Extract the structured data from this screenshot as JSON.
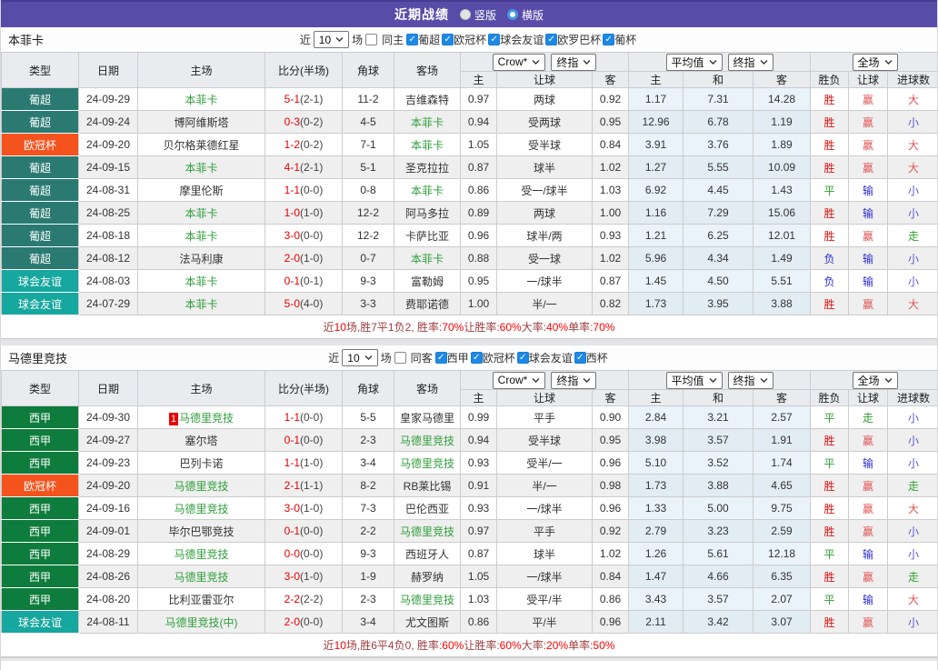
{
  "title_bar": {
    "title": "近期战绩",
    "radios": [
      {
        "label": "竖版",
        "selected": false
      },
      {
        "label": "横版",
        "selected": true
      }
    ]
  },
  "filter_words": {
    "near": "近",
    "count": "10",
    "games": "场"
  },
  "columns": {
    "type": "类型",
    "date": "日期",
    "home": "主场",
    "score": "比分(半场)",
    "corner": "角球",
    "away": "客场",
    "odds_home": "主",
    "odds_handicap": "让球",
    "odds_away": "客",
    "avg_home": "主",
    "avg_draw": "和",
    "avg_away": "客",
    "result_wdl": "胜负",
    "result_handicap": "让球",
    "result_goals": "进球数"
  },
  "dropdowns": {
    "company": "Crow*",
    "final1": "终指",
    "average": "平均值",
    "final2": "终指",
    "fulltime": "全场"
  },
  "colors": {
    "title_bar_bg": "#584ca8",
    "focal_team": "#2e9e3a",
    "score_red": "#e60000",
    "league_badge": {
      "葡超": "#2a7a72",
      "欧冠杯": "#f5531e",
      "球会友谊": "#16a79e",
      "西甲": "#0e7c3c"
    },
    "result": {
      "胜": "#e01010",
      "平": "#2f9e2f",
      "负": "#2b2bd5",
      "赢": "#e05555",
      "输": "#2b2bd5",
      "走": "#2f9e2f",
      "大": "#e05555",
      "小": "#5a55d2"
    }
  },
  "sections": [
    {
      "team": "本菲卡",
      "same_label": "同主",
      "same_checked": false,
      "leagues": [
        {
          "label": "葡超",
          "checked": true
        },
        {
          "label": "欧冠杯",
          "checked": true
        },
        {
          "label": "球会友谊",
          "checked": true
        },
        {
          "label": "欧罗巴杯",
          "checked": true
        },
        {
          "label": "葡杯",
          "checked": true
        }
      ],
      "rows": [
        {
          "type": "葡超",
          "date": "24-09-29",
          "home": "本菲卡",
          "home_focal": true,
          "home_badge": "",
          "score": "5-1",
          "half": "(2-1)",
          "corner": "11-2",
          "away": "吉维森特",
          "away_focal": false,
          "odds": [
            "0.97",
            "两球",
            "0.92"
          ],
          "avg": [
            "1.17",
            "7.31",
            "14.28"
          ],
          "results": [
            "胜",
            "赢",
            "大"
          ]
        },
        {
          "type": "葡超",
          "date": "24-09-24",
          "home": "博阿维斯塔",
          "home_focal": false,
          "home_badge": "",
          "score": "0-3",
          "half": "(0-2)",
          "corner": "4-5",
          "away": "本菲卡",
          "away_focal": true,
          "odds": [
            "0.94",
            "受两球",
            "0.95"
          ],
          "avg": [
            "12.96",
            "6.78",
            "1.19"
          ],
          "results": [
            "胜",
            "赢",
            "小"
          ]
        },
        {
          "type": "欧冠杯",
          "date": "24-09-20",
          "home": "贝尔格莱德红星",
          "home_focal": false,
          "home_badge": "",
          "score": "1-2",
          "half": "(0-2)",
          "corner": "7-1",
          "away": "本菲卡",
          "away_focal": true,
          "odds": [
            "1.05",
            "受半球",
            "0.84"
          ],
          "avg": [
            "3.91",
            "3.76",
            "1.89"
          ],
          "results": [
            "胜",
            "赢",
            "大"
          ]
        },
        {
          "type": "葡超",
          "date": "24-09-15",
          "home": "本菲卡",
          "home_focal": true,
          "home_badge": "",
          "score": "4-1",
          "half": "(2-1)",
          "corner": "5-1",
          "away": "圣克拉拉",
          "away_focal": false,
          "odds": [
            "0.87",
            "球半",
            "1.02"
          ],
          "avg": [
            "1.27",
            "5.55",
            "10.09"
          ],
          "results": [
            "胜",
            "赢",
            "大"
          ]
        },
        {
          "type": "葡超",
          "date": "24-08-31",
          "home": "摩里伦斯",
          "home_focal": false,
          "home_badge": "",
          "score": "1-1",
          "half": "(0-0)",
          "corner": "0-8",
          "away": "本菲卡",
          "away_focal": true,
          "odds": [
            "0.86",
            "受一/球半",
            "1.03"
          ],
          "avg": [
            "6.92",
            "4.45",
            "1.43"
          ],
          "results": [
            "平",
            "输",
            "小"
          ]
        },
        {
          "type": "葡超",
          "date": "24-08-25",
          "home": "本菲卡",
          "home_focal": true,
          "home_badge": "",
          "score": "1-0",
          "half": "(1-0)",
          "corner": "12-2",
          "away": "阿马多拉",
          "away_focal": false,
          "odds": [
            "0.89",
            "两球",
            "1.00"
          ],
          "avg": [
            "1.16",
            "7.29",
            "15.06"
          ],
          "results": [
            "胜",
            "输",
            "小"
          ]
        },
        {
          "type": "葡超",
          "date": "24-08-18",
          "home": "本菲卡",
          "home_focal": true,
          "home_badge": "",
          "score": "3-0",
          "half": "(0-0)",
          "corner": "12-2",
          "away": "卡萨比亚",
          "away_focal": false,
          "odds": [
            "0.96",
            "球半/两",
            "0.93"
          ],
          "avg": [
            "1.21",
            "6.25",
            "12.01"
          ],
          "results": [
            "胜",
            "赢",
            "走"
          ]
        },
        {
          "type": "葡超",
          "date": "24-08-12",
          "home": "法马利康",
          "home_focal": false,
          "home_badge": "",
          "score": "2-0",
          "half": "(1-0)",
          "corner": "0-7",
          "away": "本菲卡",
          "away_focal": true,
          "odds": [
            "0.88",
            "受一球",
            "1.02"
          ],
          "avg": [
            "5.96",
            "4.34",
            "1.49"
          ],
          "results": [
            "负",
            "输",
            "小"
          ]
        },
        {
          "type": "球会友谊",
          "date": "24-08-03",
          "home": "本菲卡",
          "home_focal": true,
          "home_badge": "",
          "score": "0-1",
          "half": "(0-1)",
          "corner": "9-3",
          "away": "富勒姆",
          "away_focal": false,
          "odds": [
            "0.95",
            "一/球半",
            "0.87"
          ],
          "avg": [
            "1.45",
            "4.50",
            "5.51"
          ],
          "results": [
            "负",
            "输",
            "小"
          ]
        },
        {
          "type": "球会友谊",
          "date": "24-07-29",
          "home": "本菲卡",
          "home_focal": true,
          "home_badge": "",
          "score": "5-0",
          "half": "(4-0)",
          "corner": "3-3",
          "away": "费耶诺德",
          "away_focal": false,
          "odds": [
            "1.00",
            "半/一",
            "0.82"
          ],
          "avg": [
            "1.73",
            "3.95",
            "3.88"
          ],
          "results": [
            "胜",
            "赢",
            "大"
          ]
        }
      ],
      "summary": [
        {
          "text": "近",
          "red": false
        },
        {
          "text": "10",
          "red": true
        },
        {
          "text": "场,胜7平1负2, 胜率:",
          "red": false
        },
        {
          "text": "70%",
          "red": true
        },
        {
          "text": " 让胜率:",
          "red": false
        },
        {
          "text": "60%",
          "red": true
        },
        {
          "text": " 大率:",
          "red": false
        },
        {
          "text": "40%",
          "red": true
        },
        {
          "text": " 单率:",
          "red": false
        },
        {
          "text": "70%",
          "red": true
        }
      ]
    },
    {
      "team": "马德里竞技",
      "same_label": "同客",
      "same_checked": false,
      "leagues": [
        {
          "label": "西甲",
          "checked": true
        },
        {
          "label": "欧冠杯",
          "checked": true
        },
        {
          "label": "球会友谊",
          "checked": true
        },
        {
          "label": "西杯",
          "checked": true
        }
      ],
      "rows": [
        {
          "type": "西甲",
          "date": "24-09-30",
          "home": "马德里竞技",
          "home_focal": true,
          "home_badge": "1",
          "score": "1-1",
          "half": "(0-0)",
          "corner": "5-5",
          "away": "皇家马德里",
          "away_focal": false,
          "odds": [
            "0.99",
            "平手",
            "0.90"
          ],
          "avg": [
            "2.84",
            "3.21",
            "2.57"
          ],
          "results": [
            "平",
            "走",
            "小"
          ]
        },
        {
          "type": "西甲",
          "date": "24-09-27",
          "home": "塞尔塔",
          "home_focal": false,
          "home_badge": "",
          "score": "0-1",
          "half": "(0-0)",
          "corner": "2-3",
          "away": "马德里竞技",
          "away_focal": true,
          "odds": [
            "0.94",
            "受半球",
            "0.95"
          ],
          "avg": [
            "3.98",
            "3.57",
            "1.91"
          ],
          "results": [
            "胜",
            "赢",
            "小"
          ]
        },
        {
          "type": "西甲",
          "date": "24-09-23",
          "home": "巴列卡诺",
          "home_focal": false,
          "home_badge": "",
          "score": "1-1",
          "half": "(1-0)",
          "corner": "3-4",
          "away": "马德里竞技",
          "away_focal": true,
          "odds": [
            "0.93",
            "受半/一",
            "0.96"
          ],
          "avg": [
            "5.10",
            "3.52",
            "1.74"
          ],
          "results": [
            "平",
            "输",
            "小"
          ]
        },
        {
          "type": "欧冠杯",
          "date": "24-09-20",
          "home": "马德里竞技",
          "home_focal": true,
          "home_badge": "",
          "score": "2-1",
          "half": "(1-1)",
          "corner": "8-2",
          "away": "RB莱比锡",
          "away_focal": false,
          "odds": [
            "0.91",
            "半/一",
            "0.98"
          ],
          "avg": [
            "1.73",
            "3.88",
            "4.65"
          ],
          "results": [
            "胜",
            "赢",
            "走"
          ]
        },
        {
          "type": "西甲",
          "date": "24-09-16",
          "home": "马德里竞技",
          "home_focal": true,
          "home_badge": "",
          "score": "3-0",
          "half": "(1-0)",
          "corner": "7-3",
          "away": "巴伦西亚",
          "away_focal": false,
          "odds": [
            "0.93",
            "一/球半",
            "0.96"
          ],
          "avg": [
            "1.33",
            "5.00",
            "9.75"
          ],
          "results": [
            "胜",
            "赢",
            "大"
          ]
        },
        {
          "type": "西甲",
          "date": "24-09-01",
          "home": "毕尔巴鄂竞技",
          "home_focal": false,
          "home_badge": "",
          "score": "0-1",
          "half": "(0-0)",
          "corner": "2-2",
          "away": "马德里竞技",
          "away_focal": true,
          "odds": [
            "0.97",
            "平手",
            "0.92"
          ],
          "avg": [
            "2.79",
            "3.23",
            "2.59"
          ],
          "results": [
            "胜",
            "赢",
            "小"
          ]
        },
        {
          "type": "西甲",
          "date": "24-08-29",
          "home": "马德里竞技",
          "home_focal": true,
          "home_badge": "",
          "score": "0-0",
          "half": "(0-0)",
          "corner": "9-3",
          "away": "西班牙人",
          "away_focal": false,
          "odds": [
            "0.87",
            "球半",
            "1.02"
          ],
          "avg": [
            "1.26",
            "5.61",
            "12.18"
          ],
          "results": [
            "平",
            "输",
            "小"
          ]
        },
        {
          "type": "西甲",
          "date": "24-08-26",
          "home": "马德里竞技",
          "home_focal": true,
          "home_badge": "",
          "score": "3-0",
          "half": "(1-0)",
          "corner": "1-9",
          "away": "赫罗纳",
          "away_focal": false,
          "odds": [
            "1.05",
            "一/球半",
            "0.84"
          ],
          "avg": [
            "1.47",
            "4.66",
            "6.35"
          ],
          "results": [
            "胜",
            "赢",
            "走"
          ]
        },
        {
          "type": "西甲",
          "date": "24-08-20",
          "home": "比利亚雷亚尔",
          "home_focal": false,
          "home_badge": "",
          "score": "2-2",
          "half": "(2-2)",
          "corner": "2-3",
          "away": "马德里竞技",
          "away_focal": true,
          "odds": [
            "1.03",
            "受平/半",
            "0.86"
          ],
          "avg": [
            "3.43",
            "3.57",
            "2.07"
          ],
          "results": [
            "平",
            "输",
            "大"
          ]
        },
        {
          "type": "球会友谊",
          "date": "24-08-11",
          "home": "马德里竞技(中)",
          "home_focal": true,
          "home_badge": "",
          "score": "2-0",
          "half": "(0-0)",
          "corner": "3-4",
          "away": "尤文图斯",
          "away_focal": false,
          "odds": [
            "0.86",
            "平/半",
            "0.96"
          ],
          "avg": [
            "2.11",
            "3.42",
            "3.07"
          ],
          "results": [
            "胜",
            "赢",
            "小"
          ]
        }
      ],
      "summary": [
        {
          "text": "近",
          "red": false
        },
        {
          "text": "10",
          "red": true
        },
        {
          "text": "场,胜6平4负0, 胜率:",
          "red": false
        },
        {
          "text": "60%",
          "red": true
        },
        {
          "text": " 让胜率:",
          "red": false
        },
        {
          "text": "60%",
          "red": true
        },
        {
          "text": " 大率:",
          "red": false
        },
        {
          "text": "20%",
          "red": true
        },
        {
          "text": " 单率:",
          "red": false
        },
        {
          "text": "50%",
          "red": true
        }
      ]
    }
  ]
}
